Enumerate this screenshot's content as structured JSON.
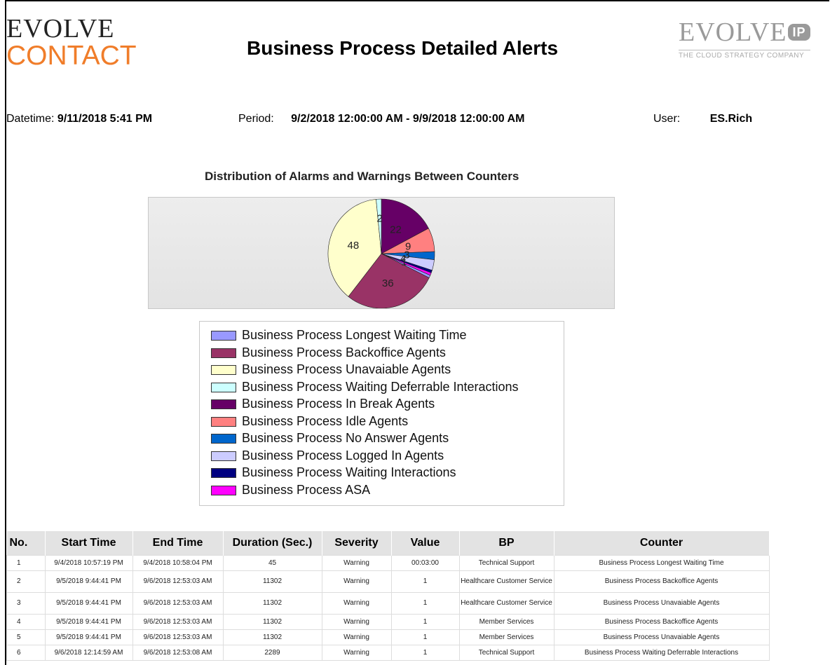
{
  "header": {
    "logo_left_line1": "EVOLVE",
    "logo_left_line2": "CONTACT",
    "title": "Business Process Detailed Alerts",
    "logo_right_main": "EVOLVE",
    "logo_right_badge": "IP",
    "logo_right_tagline": "THE CLOUD STRATEGY COMPANY"
  },
  "info": {
    "datetime_label": "Datetime:",
    "datetime_value": "9/11/2018 5:41 PM",
    "period_label": "Period:",
    "period_value": "9/2/2018 12:00:00 AM - 9/9/2018 12:00:00 AM",
    "user_label": "User:",
    "user_value": "ES.Rich"
  },
  "chart_data": {
    "type": "pie",
    "title": "Distribution of Alarms and Warnings Between Counters",
    "legend_position": "bottom",
    "slices": [
      {
        "name": "Business Process Longest Waiting Time",
        "value": 1,
        "color": "#9999ff"
      },
      {
        "name": "Business Process Backoffice Agents",
        "value": 36,
        "color": "#993366"
      },
      {
        "name": "Business Process Unavaiable Agents",
        "value": 48,
        "color": "#ffffcc"
      },
      {
        "name": "Business Process Waiting Deferrable Interactions",
        "value": 2,
        "color": "#ccffff"
      },
      {
        "name": "Business Process In Break Agents",
        "value": 22,
        "color": "#660066"
      },
      {
        "name": "Business Process Idle Agents",
        "value": 9,
        "color": "#ff8080"
      },
      {
        "name": "Business Process No Answer Agents",
        "value": 3,
        "color": "#0066cc"
      },
      {
        "name": "Business Process Logged In Agents",
        "value": 4,
        "color": "#ccccff"
      },
      {
        "name": "Business Process Waiting Interactions",
        "value": 1,
        "color": "#000080"
      },
      {
        "name": "Business Process ASA",
        "value": 1,
        "color": "#ff00ff"
      }
    ],
    "data_labels": [
      "48",
      "36",
      "22",
      "9",
      "2",
      "3",
      "4",
      "1"
    ]
  },
  "table": {
    "headers": [
      "No.",
      "Start Time",
      "End Time",
      "Duration (Sec.)",
      "Severity",
      "Value",
      "BP",
      "Counter"
    ],
    "rows": [
      [
        "1",
        "9/4/2018 10:57:19 PM",
        "9/4/2018 10:58:04 PM",
        "45",
        "Warning",
        "00:03:00",
        "Technical Support",
        "Business Process Longest Waiting Time"
      ],
      [
        "2",
        "9/5/2018 9:44:41 PM",
        "9/6/2018 12:53:03 AM",
        "11302",
        "Warning",
        "1",
        "Healthcare Customer Service",
        "Business Process Backoffice Agents"
      ],
      [
        "3",
        "9/5/2018 9:44:41 PM",
        "9/6/2018 12:53:03 AM",
        "11302",
        "Warning",
        "1",
        "Healthcare Customer Service",
        "Business Process Unavaiable Agents"
      ],
      [
        "4",
        "9/5/2018 9:44:41 PM",
        "9/6/2018 12:53:03 AM",
        "11302",
        "Warning",
        "1",
        "Member Services",
        "Business Process Backoffice Agents"
      ],
      [
        "5",
        "9/5/2018 9:44:41 PM",
        "9/6/2018 12:53:03 AM",
        "11302",
        "Warning",
        "1",
        "Member Services",
        "Business Process Unavaiable Agents"
      ],
      [
        "6",
        "9/6/2018 12:14:59 AM",
        "9/6/2018 12:53:08 AM",
        "2289",
        "Warning",
        "1",
        "Technical Support",
        "Business Process Waiting Deferrable Interactions"
      ]
    ]
  }
}
